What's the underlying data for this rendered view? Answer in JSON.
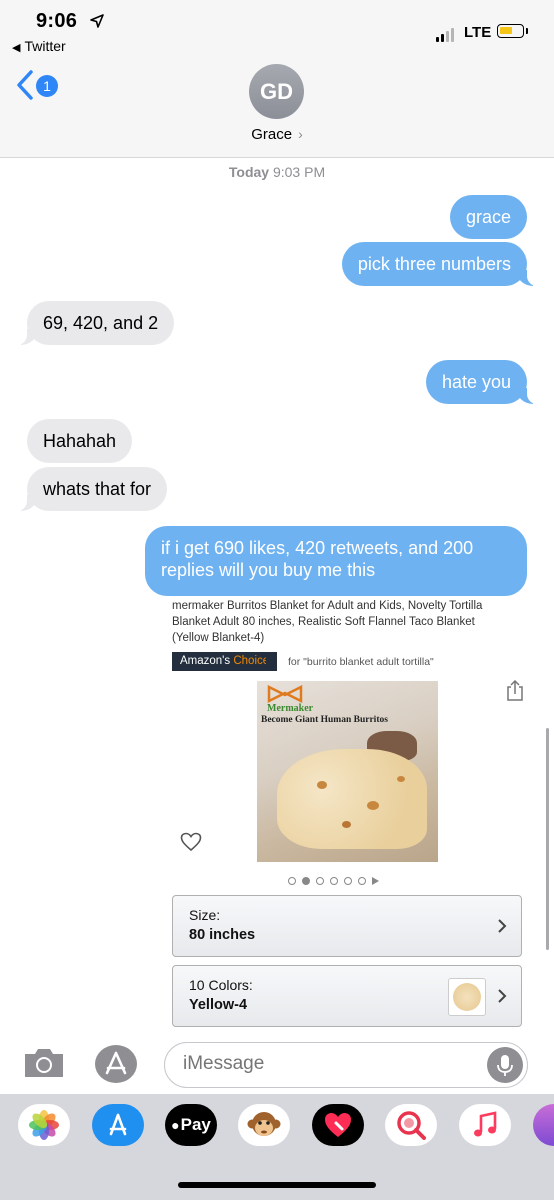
{
  "status_bar": {
    "time": "9:06",
    "back_app": "Twitter",
    "network": "LTE",
    "battery_level": 0.45,
    "battery_color": "#f5c518"
  },
  "header": {
    "unread_count": "1",
    "avatar_initials": "GD",
    "contact_name": "Grace",
    "accent_color": "#2f86f6"
  },
  "conversation": {
    "timestamp_day": "Today",
    "timestamp_time": "9:03 PM",
    "messages": [
      {
        "from": "me",
        "text": "grace"
      },
      {
        "from": "me",
        "text": "pick three numbers"
      },
      {
        "from": "them",
        "text": "69, 420, and 2"
      },
      {
        "from": "me",
        "text": "hate you"
      },
      {
        "from": "them",
        "text": "Hahahah"
      },
      {
        "from": "them",
        "text": "whats that for"
      },
      {
        "from": "me",
        "text_line1": "if i get 690 likes, 420 retweets, and 200",
        "text_line2": "replies will you buy me this"
      }
    ]
  },
  "product_preview": {
    "title_line1": "mermaker Burritos Blanket for Adult and Kids, Novelty Tortilla",
    "title_line2": "Blanket Adult 80 inches, Realistic Soft Flannel Taco Blanket",
    "title_line3": "(Yellow Blanket-4)",
    "badge_prefix": "Amazon's",
    "badge_highlight": "Choice",
    "badge_for": "for \"burrito blanket adult tortilla\"",
    "image_brand": "Mermaker",
    "image_tagline": "Become Giant Human Burritos",
    "carousel_count": 6,
    "carousel_active": 2,
    "size_label": "Size:",
    "size_value": "80 inches",
    "color_label": "10 Colors:",
    "color_value": "Yellow-4"
  },
  "input": {
    "placeholder": "iMessage"
  },
  "app_drawer": {
    "apps": [
      "photos-icon",
      "app-store-icon",
      "apple-pay-icon",
      "animoji-icon",
      "digital-touch-icon",
      "image-search-icon",
      "music-icon",
      "sticker-icon"
    ],
    "apple_pay_label": "Pay"
  }
}
